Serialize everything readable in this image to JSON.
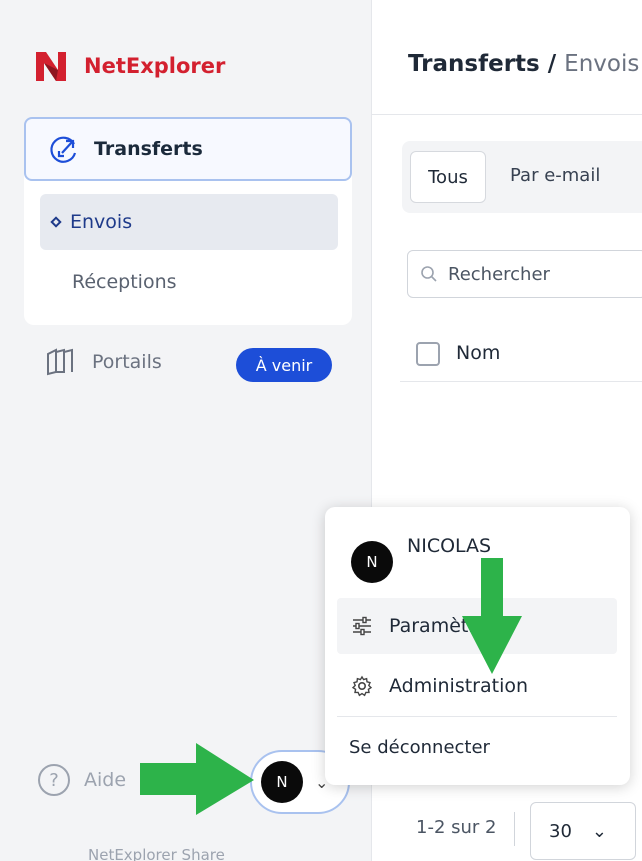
{
  "brand": {
    "name": "NetExplorer",
    "color": "#d3202f"
  },
  "sidebar": {
    "transferts_label": "Transferts",
    "envois_label": "Envois",
    "receptions_label": "Réceptions",
    "portails_label": "Portails",
    "portails_badge": "À venir",
    "aide_label": "Aide",
    "footer": "NetExplorer Share"
  },
  "user": {
    "initial": "N",
    "name": "NICOLAS"
  },
  "header": {
    "section": "Transferts",
    "separator": " / ",
    "page": "Envois"
  },
  "tabs": {
    "all": "Tous",
    "by_email": "Par e-mail"
  },
  "search": {
    "placeholder": "Rechercher"
  },
  "table": {
    "col_name": "Nom"
  },
  "pagination": {
    "range": "1-2 sur 2",
    "page_size": "30"
  },
  "menu": {
    "params_label": "Paramètres",
    "admin_label": "Administration",
    "logout_label": "Se déconnecter"
  },
  "colors": {
    "accent": "#1d4ed8",
    "arrow": "#2db34a",
    "focus_border": "#a9c2ef"
  }
}
